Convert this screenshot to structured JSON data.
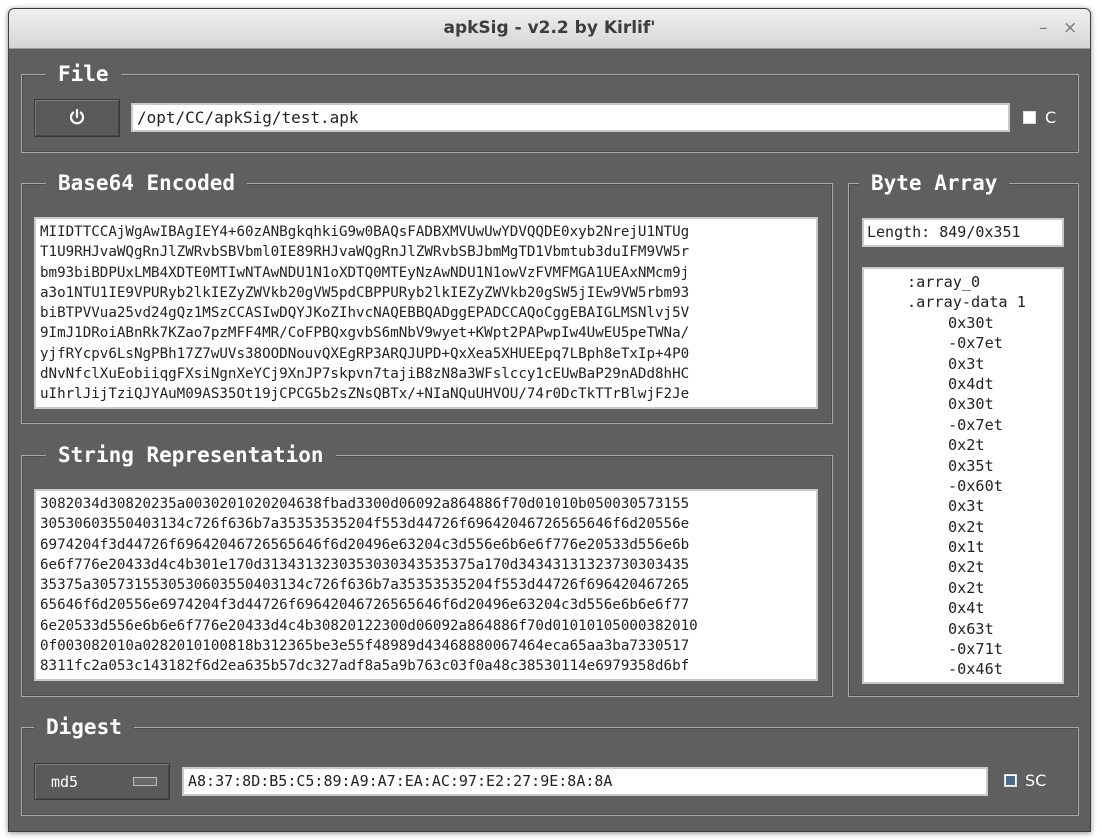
{
  "window": {
    "title": "apkSig - v2.2 by Kirlif'",
    "minimize": "–",
    "close": "×"
  },
  "file": {
    "legend": "File",
    "power_icon": "power-icon",
    "path": "/opt/CC/apkSig/test.apk",
    "checkbox_label": "C"
  },
  "base64": {
    "legend": "Base64 Encoded",
    "lines": [
      "MIIDTTCCAjWgAwIBAgIEY4+60zANBgkqhkiG9w0BAQsFADBXMVUwUwYDVQQDE0xyb2NrejU1NTUg",
      "T1U9RHJvaWQgRnJlZWRvbSBVbml0IE89RHJvaWQgRnJlZWRvbSBJbmMgTD1Vbmtub3duIFM9VW5r",
      "bm93biBDPUxLMB4XDTE0MTIwNTAwNDU1N1oXDTQ0MTEyNzAwNDU1N1owVzFVMFMGA1UEAxNMcm9j",
      "a3o1NTU1IE9VPURyb2lkIEZyZWVkb20gVW5pdCBPPURyb2lkIEZyZWVkb20gSW5jIEw9VW5rbm93",
      "biBTPVVua25vd24gQz1MSzCCASIwDQYJKoZIhvcNAQEBBQADggEPADCCAQoCggEBAIGLMSNlvj5V",
      "9ImJ1DRoiABnRk7KZao7pzMFF4MR/CoFPBQxgvbS6mNbV9wyet+KWpt2PAPwpIw4UwEU5peTWNa/",
      "yjfRYcpv6LsNgPBh17Z7wUVs38OODNouvQXEgRP3ARQJUPD+QxXea5XHUEEpq7LBph8eTxIp+4P0",
      "dNvNfclXuEobiiqgFXsiNgnXeYCj9XnJP7skpvn7tajiB8zN8a3WFslccy1cEUwBaP29nADd8hHC",
      "uIhrlJijTziQJYAuM09AS35Ot19jCPCG5b2sZNsQBTx/+NIaNQuUHVOU/74r0DcTkTTrBlwjF2Je"
    ]
  },
  "string_rep": {
    "legend": "String Representation",
    "lines": [
      "3082034d30820235a0030201020204638fbad3300d06092a864886f70d01010b050030573155",
      "30530603550403134c726f636b7a35353535204f553d44726f69642046726565646f6d20556e",
      "6974204f3d44726f69642046726565646f6d20496e63204c3d556e6b6e6f776e20533d556e6b",
      "6e6f776e20433d4c4b301e170d3134313230353030343535375a170d34343131323730303435",
      "35375a3057315530530603550403134c726f636b7a35353535204f553d44726f696420467265",
      "65646f6d20556e6974204f3d44726f69642046726565646f6d20496e63204c3d556e6b6e6f77",
      "6e20533d556e6b6e6f776e20433d4c4b30820122300d06092a864886f70d01010105000382010",
      "0f003082010a0282010100818b312365be3e55f48989d43468880067464eca65aa3ba7330517",
      "8311fc2a053c143182f6d2ea635b57dc327adf8a5a9b763c03f0a48c38530114e6979358d6bf"
    ]
  },
  "byte_array": {
    "legend": "Byte Array",
    "length": "Length: 849/0x351",
    "header_lines": [
      ":array_0",
      ".array-data 1"
    ],
    "values": [
      "0x30t",
      "-0x7et",
      "0x3t",
      "0x4dt",
      "0x30t",
      "-0x7et",
      "0x2t",
      "0x35t",
      "-0x60t",
      "0x3t",
      "0x2t",
      "0x1t",
      "0x2t",
      "0x2t",
      "0x4t",
      "0x63t",
      "-0x71t",
      "-0x46t"
    ]
  },
  "digest": {
    "legend": "Digest",
    "algorithm": "md5",
    "value": "A8:37:8D:B5:C5:89:A9:A7:EA:AC:97:E2:27:9E:8A:8A",
    "checkbox_label": "SC"
  },
  "colors": {
    "window_bg": "#5f5f5f",
    "checkbox_checked": "#4b6a8a"
  }
}
